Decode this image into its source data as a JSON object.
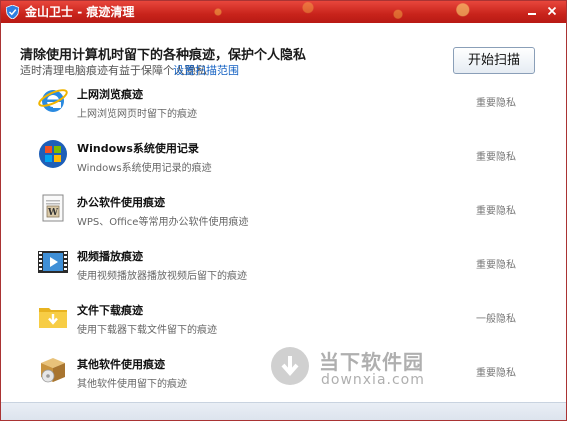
{
  "window": {
    "app_name": "金山卫士",
    "separator": " - ",
    "section_title": "痕迹清理",
    "accent_color": "#c8231b"
  },
  "header": {
    "headline": "清除使用计算机时留下的各种痕迹，保护个人隐私",
    "subline": "适时清理电脑痕迹有益于保障个人隐私",
    "scope_link": "设置扫描范围",
    "scan_button": "开始扫描"
  },
  "items": [
    {
      "icon": "ie-browser-icon",
      "title": "上网浏览痕迹",
      "desc": "上网浏览网页时留下的痕迹",
      "level": "重要隐私"
    },
    {
      "icon": "windows-logo-icon",
      "title": "Windows系统使用记录",
      "desc": "Windows系统使用记录的痕迹",
      "level": "重要隐私"
    },
    {
      "icon": "office-document-icon",
      "title": "办公软件使用痕迹",
      "desc": "WPS、Office等常用办公软件使用痕迹",
      "level": "重要隐私"
    },
    {
      "icon": "video-player-icon",
      "title": "视频播放痕迹",
      "desc": "使用视频播放器播放视频后留下的痕迹",
      "level": "重要隐私"
    },
    {
      "icon": "download-folder-icon",
      "title": "文件下载痕迹",
      "desc": "使用下载器下载文件留下的痕迹",
      "level": "一般隐私"
    },
    {
      "icon": "software-box-icon",
      "title": "其他软件使用痕迹",
      "desc": "其他软件使用留下的痕迹",
      "level": "重要隐私"
    }
  ],
  "watermark": {
    "brand": "当下软件园",
    "domain": "downxia.com"
  }
}
